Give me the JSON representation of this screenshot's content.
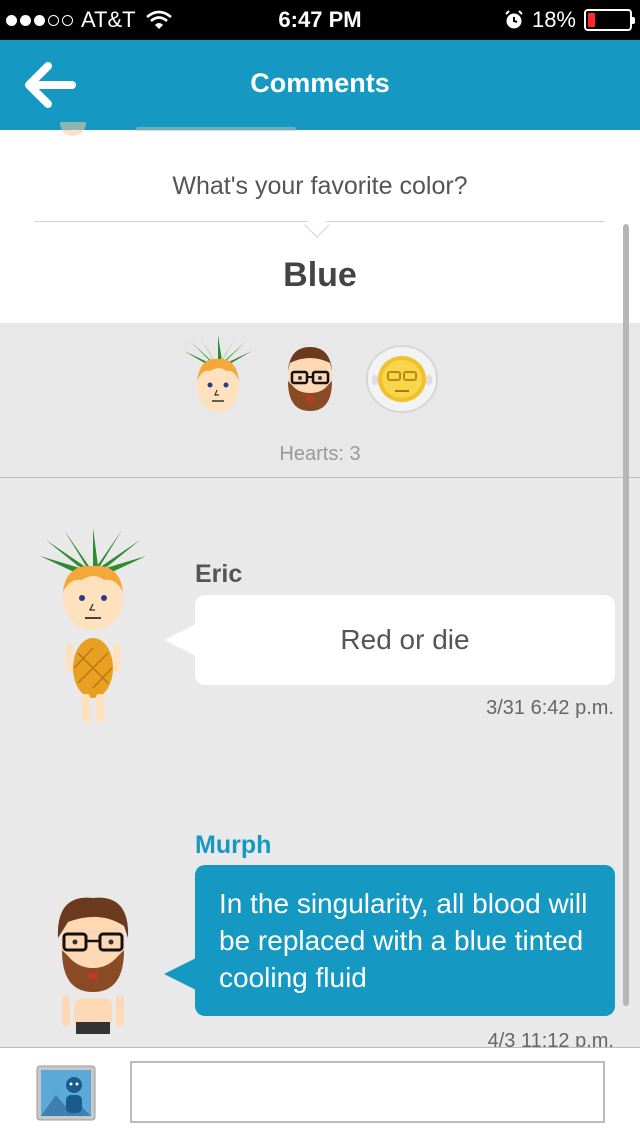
{
  "status_bar": {
    "carrier": "AT&T",
    "time": "6:47 PM",
    "battery": "18%",
    "battery_level": 0.18,
    "signal_bars": 3,
    "signal_max": 5,
    "icons": [
      "signal-dots-icon",
      "wifi-icon",
      "alarm-icon",
      "battery-icon"
    ]
  },
  "nav": {
    "title": "Comments",
    "back_icon": "arrow-left-icon"
  },
  "post": {
    "question": "What's your favorite color?",
    "answer": "Blue"
  },
  "hearts": {
    "label": "Hearts: 3",
    "avatars": [
      "pineapple-mii-avatar",
      "bearded-glasses-mii-avatar",
      "astronaut-mii-avatar"
    ]
  },
  "comments": [
    {
      "author": "Eric",
      "text": "Red or die",
      "timestamp": "3/31 6:42 p.m.",
      "avatar": "pineapple-mii-avatar",
      "own": false
    },
    {
      "author": "Murph",
      "text": "In the singularity, all blood will be replaced with a blue tinted cooling fluid",
      "timestamp": "4/3 11:12 p.m.",
      "avatar": "bearded-glasses-mii-avatar",
      "own": true
    }
  ],
  "composer": {
    "input_value": "",
    "image_button_icon": "image-upload-icon"
  },
  "colors": {
    "accent": "#1599c2",
    "status_bar": "#000000",
    "background": "#e8e8e8",
    "battery_low": "#ff2b2b"
  }
}
